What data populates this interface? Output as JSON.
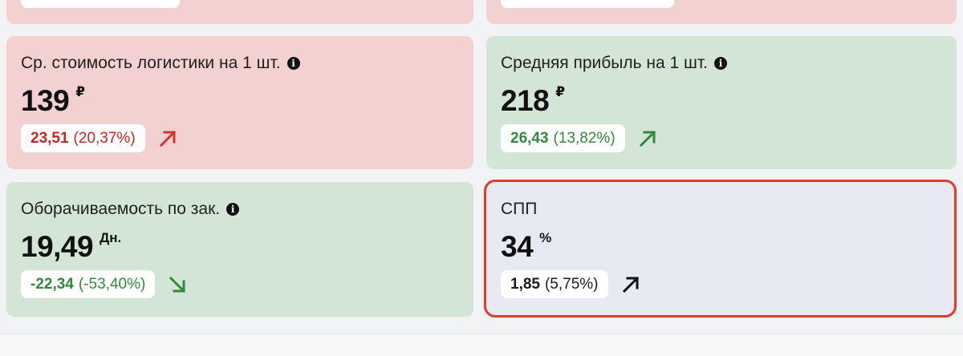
{
  "cards": [
    {
      "title": "Ср. стоимость логистики на 1 шт.",
      "value": "139",
      "unit": "₽",
      "change_abs": "23,51",
      "change_pct": "(20,37%)",
      "status": "negative",
      "trend": "up"
    },
    {
      "title": "Средняя прибыль на 1 шт.",
      "value": "218",
      "unit": "₽",
      "change_abs": "26,43",
      "change_pct": "(13,82%)",
      "status": "positive",
      "trend": "up"
    },
    {
      "title": "Оборачиваемость по зак.",
      "value": "19,49",
      "unit": "Дн.",
      "change_abs": "-22,34",
      "change_pct": "(-53,40%)",
      "status": "positive",
      "trend": "down"
    },
    {
      "title": "СПП",
      "value": "34",
      "unit": "%",
      "change_abs": "1,85",
      "change_pct": "(5,75%)",
      "status": "neutral",
      "trend": "up",
      "highlighted": true
    }
  ],
  "colors": {
    "negative_bg": "#f3d1d1",
    "positive_bg": "#d3e6d6",
    "neutral_bg": "#e7eaf2",
    "negative_text": "#c7261f",
    "positive_text": "#2f8a3b",
    "highlight_border": "#e23a2b"
  },
  "icons": {
    "info": "info-icon",
    "trend_up": "arrow-up-right-icon",
    "trend_down": "arrow-down-right-icon"
  }
}
